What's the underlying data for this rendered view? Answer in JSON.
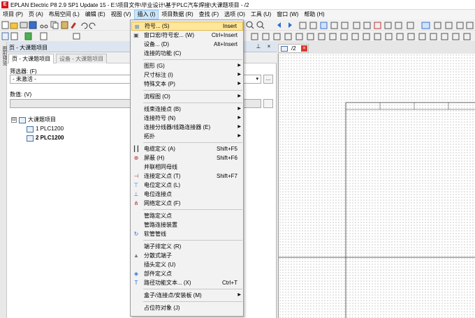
{
  "titlebar": {
    "logo": "E",
    "title": "EPLAN Electric P8 2.9 SP1 Update 15 - E:\\项目文件\\毕业设计\\基于PLC汽车焊接\\大课题项目 - /2"
  },
  "menubar": [
    {
      "label": "项目 (P)",
      "active": false
    },
    {
      "label": "页 (A)",
      "active": false
    },
    {
      "label": "布局空间 (L)",
      "active": false
    },
    {
      "label": "编辑 (E)",
      "active": false
    },
    {
      "label": "视图 (V)",
      "active": false
    },
    {
      "label": "插入 (I)",
      "active": true
    },
    {
      "label": "项目数据 (R)",
      "active": false
    },
    {
      "label": "查找 (F)",
      "active": false
    },
    {
      "label": "选项 (O)",
      "active": false
    },
    {
      "label": "工具 (U)",
      "active": false
    },
    {
      "label": "窗口 (W)",
      "active": false
    },
    {
      "label": "帮助 (H)",
      "active": false
    }
  ],
  "sidetab": {
    "label": "图形预览"
  },
  "panel": {
    "title": "页 - 大课题项目",
    "pin": "⊥",
    "close": "×",
    "tabs": [
      "页 - 大课题项目",
      "设备 - 大课题项目"
    ],
    "filter_label": "筛选器: (F)",
    "filter_value": "- 未激活 -",
    "filter_btn": "...",
    "value_label": "数值: (V)",
    "tree": [
      {
        "label": "大课题项目",
        "bold": false,
        "expander": "⊟"
      },
      {
        "label": "1 PLC1200",
        "bold": false
      },
      {
        "label": "2 PLC1200",
        "bold": true
      }
    ]
  },
  "drawing": {
    "tab_label": "/2",
    "close": "×"
  },
  "insert_menu": {
    "items": [
      {
        "label": "符号... (S)",
        "shortcut": "Insert",
        "highlight": true,
        "icon": "symbol-icon"
      },
      {
        "label": "窗口宏/符号宏... (W)",
        "shortcut": "Ctrl+Insert",
        "icon": "macro-icon"
      },
      {
        "label": "设备... (D)",
        "shortcut": "Alt+Insert",
        "icon": ""
      },
      {
        "label": "连接的功能 (C)",
        "shortcut": "",
        "icon": ""
      },
      {
        "sep": true
      },
      {
        "label": "图形 (G)",
        "submenu": true
      },
      {
        "label": "尺寸标注 (I)",
        "submenu": true
      },
      {
        "label": "特殊文本 (P)",
        "submenu": true
      },
      {
        "sep": true
      },
      {
        "label": "流程图 (O)",
        "submenu": true
      },
      {
        "sep": true
      },
      {
        "label": "线束连接点 (B)",
        "submenu": true
      },
      {
        "label": "连接符号 (N)",
        "submenu": true
      },
      {
        "label": "连接分线器/线路连接器 (E)",
        "submenu": true
      },
      {
        "label": "拓扑",
        "submenu": true
      },
      {
        "sep": true
      },
      {
        "label": "电缆定义 (A)",
        "shortcut": "Shift+F5",
        "icon": "cable-definition-icon"
      },
      {
        "label": "屏蔽 (H)",
        "shortcut": "Shift+F6",
        "icon": "shield-icon"
      },
      {
        "label": "并联相同母线",
        "shortcut": ""
      },
      {
        "label": "连接定义点 (T)",
        "shortcut": "Shift+F7",
        "icon": "connection-definition-icon"
      },
      {
        "label": "电位定义点 (L)",
        "shortcut": "",
        "icon": "potential-definition-icon"
      },
      {
        "label": "电位连接点",
        "shortcut": "",
        "icon": "potential-connection-icon"
      },
      {
        "label": "网络定义点 (F)",
        "shortcut": "",
        "icon": "network-definition-icon"
      },
      {
        "sep": true
      },
      {
        "label": "管路定义点",
        "shortcut": ""
      },
      {
        "label": "管路连接装置",
        "shortcut": ""
      },
      {
        "label": "软管管线",
        "shortcut": "",
        "icon": "hose-icon"
      },
      {
        "sep": true
      },
      {
        "label": "端子排定义 (R)",
        "shortcut": ""
      },
      {
        "label": "分散式端子",
        "shortcut": "",
        "icon": "distributed-terminal-icon"
      },
      {
        "label": "插头定义 (U)",
        "shortcut": ""
      },
      {
        "label": "部件定义点",
        "shortcut": "",
        "icon": "part-definition-icon"
      },
      {
        "label": "路径功能文本... (X)",
        "shortcut": "Ctrl+T",
        "icon": "path-text-icon"
      },
      {
        "sep": true
      },
      {
        "label": "盒子/连接点/安装板 (M)",
        "submenu": true
      },
      {
        "sep": true
      },
      {
        "label": "占位符对象 (J)",
        "shortcut": ""
      }
    ]
  },
  "colors": {
    "accent": "#ffe699",
    "close_red": "#d83b2e",
    "panel_header": "#dde6f0"
  }
}
